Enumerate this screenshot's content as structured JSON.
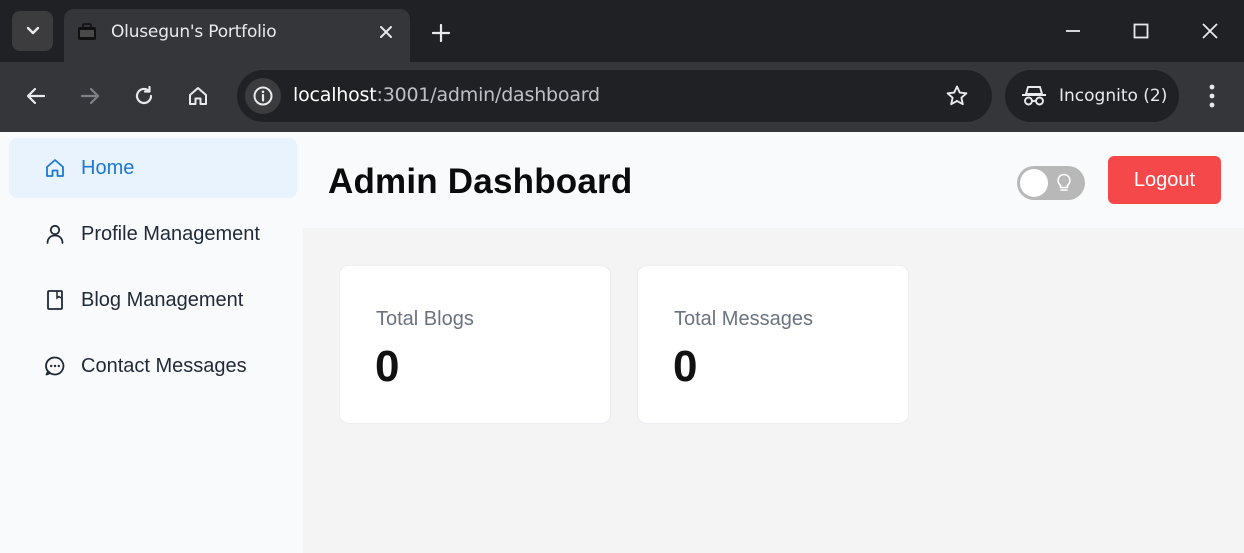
{
  "browser": {
    "tab_title": "Olusegun's Portfolio",
    "url_host": "localhost",
    "url_rest": ":3001/admin/dashboard",
    "incognito_label": "Incognito (2)"
  },
  "sidebar": {
    "items": [
      {
        "label": "Home",
        "icon": "home-icon",
        "active": true
      },
      {
        "label": "Profile Management",
        "icon": "user-icon",
        "active": false
      },
      {
        "label": "Blog Management",
        "icon": "book-icon",
        "active": false
      },
      {
        "label": "Contact Messages",
        "icon": "chat-icon",
        "active": false
      }
    ]
  },
  "header": {
    "title": "Admin Dashboard",
    "theme_toggle_on": false,
    "logout_label": "Logout"
  },
  "stats": [
    {
      "label": "Total Blogs",
      "value": "0"
    },
    {
      "label": "Total Messages",
      "value": "0"
    }
  ],
  "colors": {
    "accent": "#1d78d0",
    "logout": "#f4484a",
    "active_bg": "#e8f3fe"
  }
}
